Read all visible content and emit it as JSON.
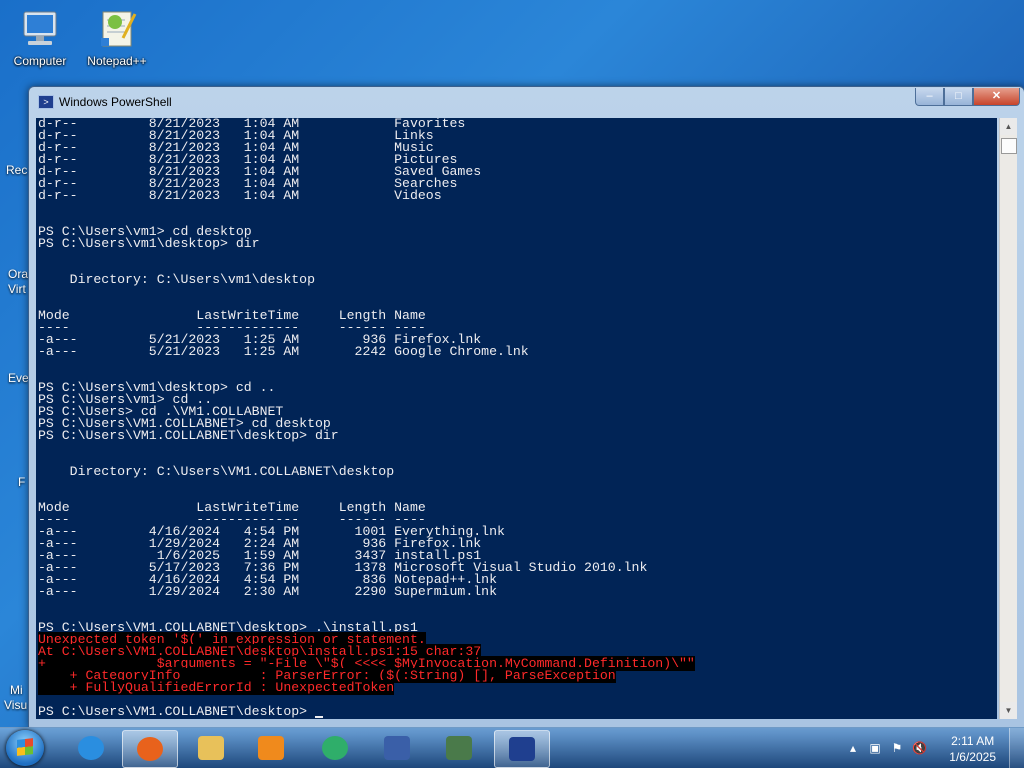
{
  "desktop": {
    "icons": [
      {
        "label": "Computer"
      },
      {
        "label": "Notepad++"
      }
    ],
    "partial_labels": [
      "Rec",
      "Ora",
      "Virt",
      "Eve",
      "F",
      "Mi",
      "Visu"
    ]
  },
  "window": {
    "title": "Windows PowerShell",
    "controls": {
      "minimize": "–",
      "maximize": "□",
      "close": "✕"
    }
  },
  "console": {
    "lines": [
      "d-r--         8/21/2023   1:04 AM            Favorites",
      "d-r--         8/21/2023   1:04 AM            Links",
      "d-r--         8/21/2023   1:04 AM            Music",
      "d-r--         8/21/2023   1:04 AM            Pictures",
      "d-r--         8/21/2023   1:04 AM            Saved Games",
      "d-r--         8/21/2023   1:04 AM            Searches",
      "d-r--         8/21/2023   1:04 AM            Videos",
      "",
      "",
      "PS C:\\Users\\vm1> cd desktop",
      "PS C:\\Users\\vm1\\desktop> dir",
      "",
      "",
      "    Directory: C:\\Users\\vm1\\desktop",
      "",
      "",
      "Mode                LastWriteTime     Length Name",
      "----                -------------     ------ ----",
      "-a---         5/21/2023   1:25 AM        936 Firefox.lnk",
      "-a---         5/21/2023   1:25 AM       2242 Google Chrome.lnk",
      "",
      "",
      "PS C:\\Users\\vm1\\desktop> cd ..",
      "PS C:\\Users\\vm1> cd ..",
      "PS C:\\Users> cd .\\VM1.COLLABNET",
      "PS C:\\Users\\VM1.COLLABNET> cd desktop",
      "PS C:\\Users\\VM1.COLLABNET\\desktop> dir",
      "",
      "",
      "    Directory: C:\\Users\\VM1.COLLABNET\\desktop",
      "",
      "",
      "Mode                LastWriteTime     Length Name",
      "----                -------------     ------ ----",
      "-a---         4/16/2024   4:54 PM       1001 Everything.lnk",
      "-a---         1/29/2024   2:24 AM        936 Firefox.lnk",
      "-a---          1/6/2025   1:59 AM       3437 install.ps1",
      "-a---         5/17/2023   7:36 PM       1378 Microsoft Visual Studio 2010.lnk",
      "-a---         4/16/2024   4:54 PM        836 Notepad++.lnk",
      "-a---         1/29/2024   2:30 AM       2290 Supermium.lnk",
      "",
      "",
      "PS C:\\Users\\VM1.COLLABNET\\desktop> .\\install.ps1"
    ],
    "error_lines": [
      "Unexpected token '$(' in expression or statement.",
      "At C:\\Users\\VM1.COLLABNET\\desktop\\install.ps1:15 char:37",
      "+              $arguments = \"-File \\\"$( <<<< $MyInvocation.MyCommand.Definition)\\\"\"",
      "    + CategoryInfo          : ParserError: ($(:String) [], ParseException",
      "    + FullyQualifiedErrorId : UnexpectedToken"
    ],
    "prompt": "PS C:\\Users\\VM1.COLLABNET\\desktop> "
  },
  "taskbar": {
    "apps": [
      {
        "name": "internet-explorer",
        "color": "#2a8ee0"
      },
      {
        "name": "firefox",
        "color": "#e8621c",
        "active": true
      },
      {
        "name": "file-explorer",
        "color": "#e8c15a"
      },
      {
        "name": "media-player",
        "color": "#f08a1c"
      },
      {
        "name": "app-green",
        "color": "#2fae6a"
      },
      {
        "name": "virtualbox",
        "color": "#3a5fa8"
      },
      {
        "name": "app-chart",
        "color": "#4a7a4a"
      },
      {
        "name": "powershell",
        "color": "#1f3f8f",
        "active": true
      }
    ],
    "clock": {
      "time": "2:11 AM",
      "date": "1/6/2025"
    }
  }
}
